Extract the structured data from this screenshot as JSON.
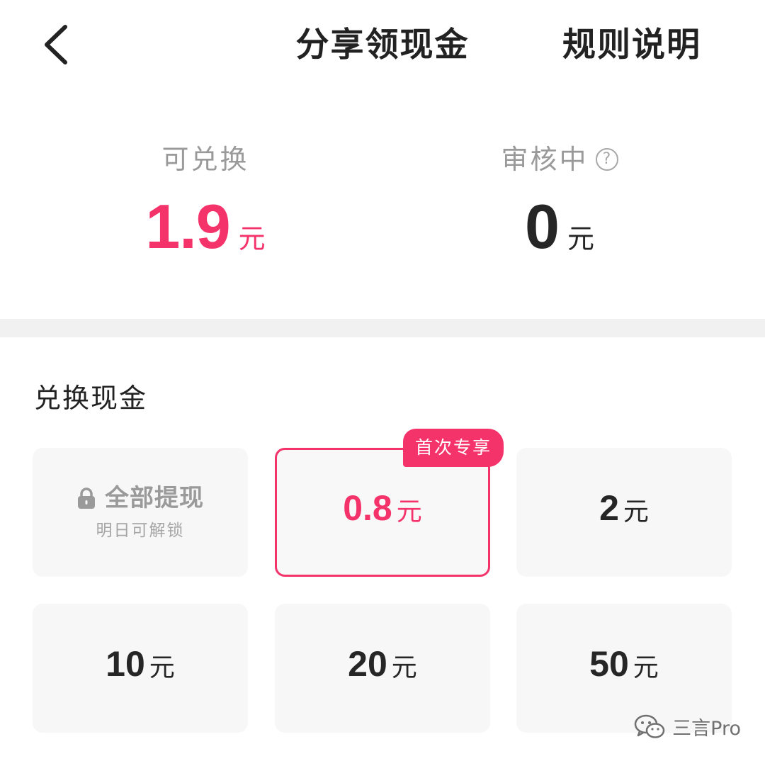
{
  "header": {
    "title": "分享领现金",
    "rules_label": "规则说明"
  },
  "balance": {
    "available": {
      "label": "可兑换",
      "value": "1.9",
      "unit": "元"
    },
    "reviewing": {
      "label": "审核中",
      "value": "0",
      "unit": "元"
    }
  },
  "exchange": {
    "title": "兑换现金",
    "locked_option": {
      "label": "全部提现",
      "sub": "明日可解锁"
    },
    "options": [
      {
        "value": "0.8",
        "unit": "元",
        "badge": "首次专享",
        "selected": true
      },
      {
        "value": "2",
        "unit": "元"
      },
      {
        "value": "10",
        "unit": "元"
      },
      {
        "value": "20",
        "unit": "元"
      },
      {
        "value": "50",
        "unit": "元"
      }
    ]
  },
  "watermark": {
    "text": "三言Pro"
  },
  "colors": {
    "accent": "#f5336b",
    "card_bg": "#f7f7f7",
    "divider": "#f1f1f1",
    "muted_text": "#9a9a9a",
    "primary_text": "#222222"
  },
  "icons": {
    "back": "chevron-left-icon",
    "help": "question-circle-icon",
    "lock": "lock-icon",
    "watermark": "wechat-icon"
  }
}
